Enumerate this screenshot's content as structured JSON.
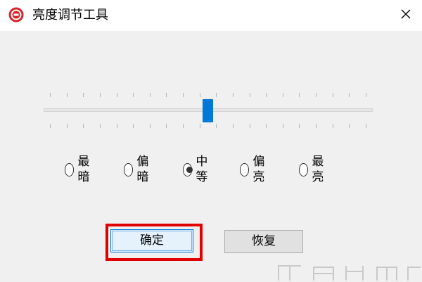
{
  "window": {
    "title": "亮度调节工具",
    "close_icon": "close-icon",
    "app_icon": "app-logo-icon"
  },
  "slider": {
    "tick_count": 20,
    "value_fraction": 0.5
  },
  "radio_options": [
    {
      "label": "最暗",
      "checked": false
    },
    {
      "label": "偏暗",
      "checked": false
    },
    {
      "label": "中等",
      "checked": true
    },
    {
      "label": "偏亮",
      "checked": false
    },
    {
      "label": "最亮",
      "checked": false
    }
  ],
  "buttons": {
    "confirm_label": "确定",
    "restore_label": "恢复"
  },
  "colors": {
    "accent": "#0078d7",
    "highlight": "#e00000",
    "dialog_bg": "#f0f0f0"
  }
}
